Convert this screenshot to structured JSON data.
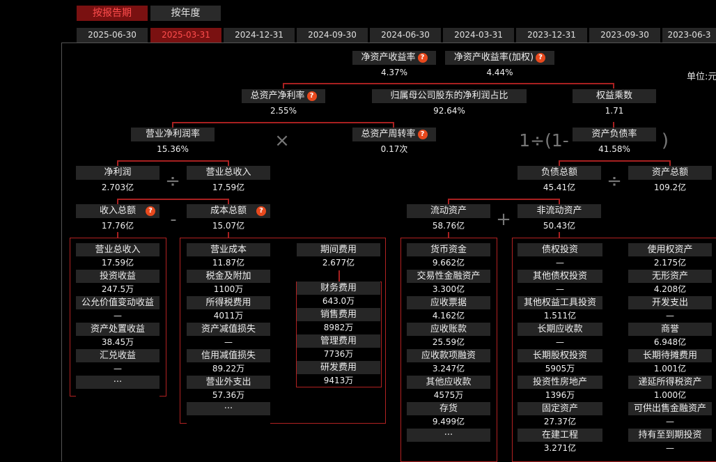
{
  "tabs": {
    "by_report": "按报告期",
    "by_year": "按年度"
  },
  "dates": [
    "2025-06-30",
    "2025-03-31",
    "2024-12-31",
    "2024-09-30",
    "2024-06-30",
    "2024-03-31",
    "2023-12-31",
    "2023-09-30",
    "2023-06-3"
  ],
  "active_date_index": 1,
  "unit_label": "单位:元",
  "help_glyph": "?",
  "operators": {
    "multiply": "×",
    "divide": "÷",
    "minus": "-",
    "plus": "+",
    "equity_prefix": "1÷(1-",
    "close_paren": ")"
  },
  "nodes": {
    "roe": {
      "label": "净资产收益率",
      "value": "4.37%"
    },
    "roe_weighted": {
      "label": "净资产收益率(加权)",
      "value": "4.44%"
    },
    "roa": {
      "label": "总资产净利率",
      "value": "2.55%"
    },
    "parent_ratio": {
      "label": "归属母公司股东的净利润占比",
      "value": "92.64%"
    },
    "equity_multiplier": {
      "label": "权益乘数",
      "value": "1.71"
    },
    "net_margin": {
      "label": "营业净利润率",
      "value": "15.36%"
    },
    "asset_turnover": {
      "label": "总资产周转率",
      "value": "0.17次"
    },
    "debt_ratio": {
      "label": "资产负债率",
      "value": "41.58%"
    },
    "net_profit": {
      "label": "净利润",
      "value": "2.703亿"
    },
    "revenue": {
      "label": "营业总收入",
      "value": "17.59亿"
    },
    "total_liabilities": {
      "label": "负债总额",
      "value": "45.41亿"
    },
    "total_assets": {
      "label": "资产总额",
      "value": "109.2亿"
    },
    "total_income": {
      "label": "收入总额",
      "value": "17.76亿"
    },
    "total_cost": {
      "label": "成本总额",
      "value": "15.07亿"
    },
    "current_assets": {
      "label": "流动资产",
      "value": "58.76亿"
    },
    "noncurrent_assets": {
      "label": "非流动资产",
      "value": "50.43亿"
    }
  },
  "income_items": [
    {
      "label": "营业总收入",
      "value": "17.59亿"
    },
    {
      "label": "投资收益",
      "value": "247.5万"
    },
    {
      "label": "公允价值变动收益",
      "value": "—"
    },
    {
      "label": "资产处置收益",
      "value": "38.45万"
    },
    {
      "label": "汇兑收益",
      "value": "—"
    },
    {
      "label": "···",
      "value": ""
    }
  ],
  "cost_items": [
    {
      "label": "营业成本",
      "value": "11.87亿"
    },
    {
      "label": "税金及附加",
      "value": "1100万"
    },
    {
      "label": "所得税费用",
      "value": "4011万"
    },
    {
      "label": "资产减值损失",
      "value": "—"
    },
    {
      "label": "信用减值损失",
      "value": "89.22万"
    },
    {
      "label": "营业外支出",
      "value": "57.36万"
    },
    {
      "label": "···",
      "value": ""
    }
  ],
  "period_expense": {
    "label": "期间费用",
    "value": "2.677亿"
  },
  "expense_items": [
    {
      "label": "财务费用",
      "value": "643.0万"
    },
    {
      "label": "销售费用",
      "value": "8982万"
    },
    {
      "label": "管理费用",
      "value": "7736万"
    },
    {
      "label": "研发费用",
      "value": "9413万"
    }
  ],
  "current_items": [
    {
      "label": "货币资金",
      "value": "9.662亿"
    },
    {
      "label": "交易性金融资产",
      "value": "3.300亿"
    },
    {
      "label": "应收票据",
      "value": "4.162亿"
    },
    {
      "label": "应收账款",
      "value": "25.59亿"
    },
    {
      "label": "应收款项融资",
      "value": "3.247亿"
    },
    {
      "label": "其他应收款",
      "value": "4575万"
    },
    {
      "label": "存货",
      "value": "9.499亿"
    },
    {
      "label": "···",
      "value": ""
    }
  ],
  "noncurrent_items_a": [
    {
      "label": "债权投资",
      "value": "—"
    },
    {
      "label": "其他债权投资",
      "value": "—"
    },
    {
      "label": "其他权益工具投资",
      "value": "1.511亿"
    },
    {
      "label": "长期应收款",
      "value": "—"
    },
    {
      "label": "长期股权投资",
      "value": "5905万"
    },
    {
      "label": "投资性房地产",
      "value": "1396万"
    },
    {
      "label": "固定资产",
      "value": "27.37亿"
    },
    {
      "label": "在建工程",
      "value": "3.271亿"
    }
  ],
  "noncurrent_items_b": [
    {
      "label": "使用权资产",
      "value": "2.175亿"
    },
    {
      "label": "无形资产",
      "value": "4.208亿"
    },
    {
      "label": "开发支出",
      "value": "—"
    },
    {
      "label": "商誉",
      "value": "6.948亿"
    },
    {
      "label": "长期待摊费用",
      "value": "1.001亿"
    },
    {
      "label": "递延所得税资产",
      "value": "1.000亿"
    },
    {
      "label": "可供出售金融资产",
      "value": "—"
    },
    {
      "label": "持有至到期投资",
      "value": "—"
    }
  ],
  "colors": {
    "accent": "#7a1111",
    "accent_text": "#ff4d4d",
    "line": "#a82020",
    "cell_bg": "#262626",
    "help_badge": "#e8491d"
  }
}
